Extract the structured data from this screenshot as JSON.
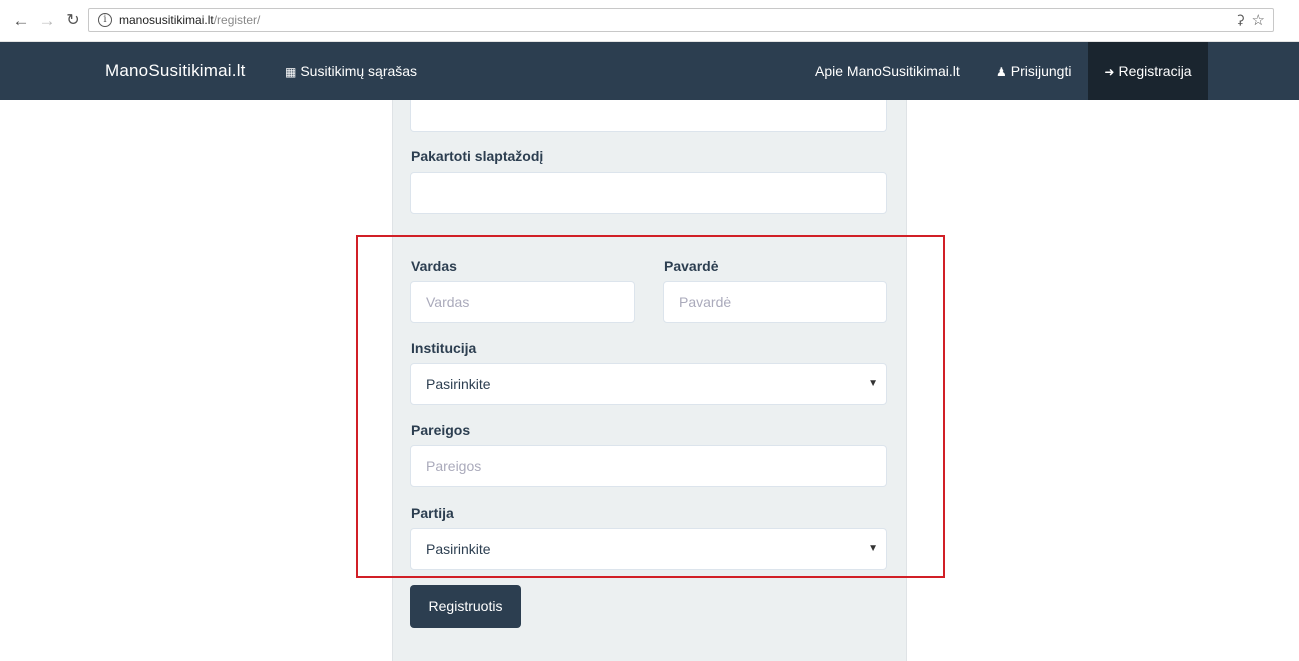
{
  "browser": {
    "url_host": "manosusitikimai.lt",
    "url_path": "/register/"
  },
  "navbar": {
    "brand": "ManoSusitikimai.lt",
    "list_link": "Susitikimų sąrašas",
    "about_link": "Apie ManoSusitikimai.lt",
    "login_link": "Prisijungti",
    "register_link": "Registracija"
  },
  "form": {
    "repeat_password_label": "Pakartoti slaptažodį",
    "first_name_label": "Vardas",
    "first_name_placeholder": "Vardas",
    "last_name_label": "Pavardė",
    "last_name_placeholder": "Pavardė",
    "institution_label": "Institucija",
    "institution_selected": "Pasirinkite",
    "position_label": "Pareigos",
    "position_placeholder": "Pareigos",
    "party_label": "Partija",
    "party_selected": "Pasirinkite",
    "submit_label": "Registruotis"
  },
  "colors": {
    "navbar_bg": "#2c3e50",
    "panel_bg": "#ecf0f1",
    "highlight": "#d11f26"
  },
  "icons": {
    "list_link": "calendar-icon",
    "login_link": "user-icon",
    "register_link": "sign-in-icon"
  }
}
